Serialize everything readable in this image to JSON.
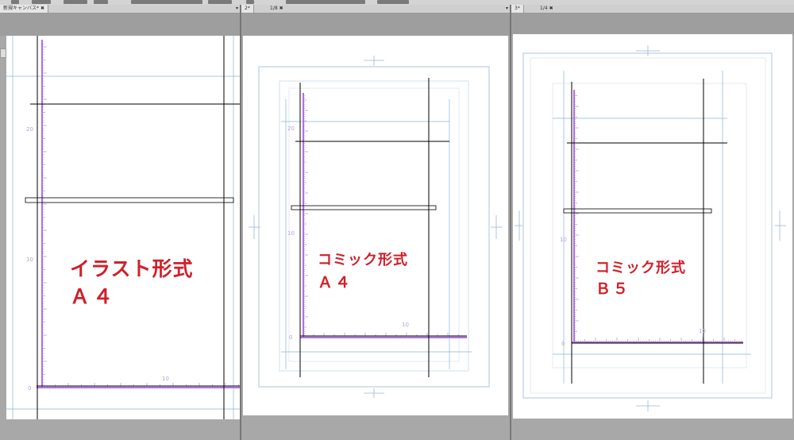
{
  "tabs": [
    {
      "title": "新規キャンバス*",
      "close": "✖",
      "dropdown": "▾"
    },
    {
      "title": "2*",
      "page": "1/8",
      "close": "✖",
      "dropdown": "▾"
    },
    {
      "title": "3*",
      "page": "1/4",
      "close": "✖",
      "dropdown": "▾"
    }
  ],
  "canvases": [
    {
      "line1": "イラスト形式",
      "line2": "Ａ４"
    },
    {
      "line1": "コミック形式",
      "line2": "Ａ４"
    },
    {
      "line1": "コミック形式",
      "line2": "Ｂ５"
    }
  ],
  "ruler_labels": {
    "p1_v_top": "20",
    "p1_v_mid": "10",
    "p1_origin": "0",
    "p1_h": "10",
    "p2_v_top": "20",
    "p2_v_mid": "10",
    "p2_origin": "0",
    "p2_h": "10",
    "p3_v_mid": "10",
    "p3_origin": "0",
    "p3_h": "10"
  },
  "colors": {
    "label": "#d0202a",
    "ruler": "#b070e0",
    "guide": "#8ab4d8",
    "frame": "#000000"
  }
}
